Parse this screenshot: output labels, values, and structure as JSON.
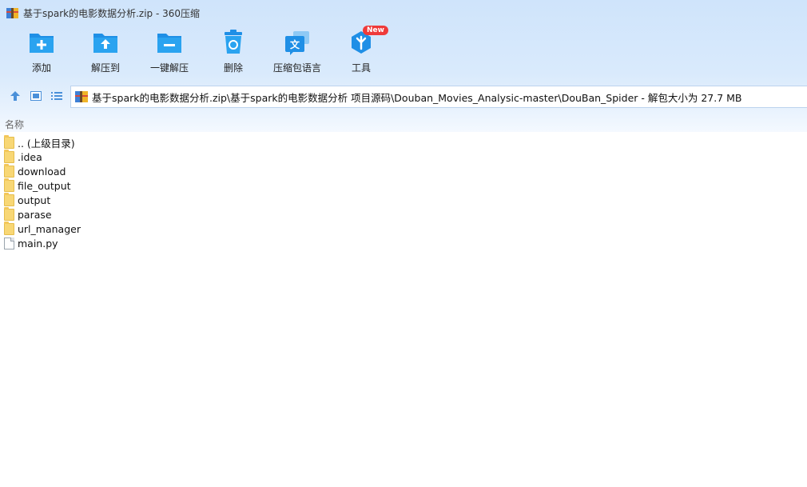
{
  "window": {
    "title": "基于spark的电影数据分析.zip - 360压缩"
  },
  "toolbar": {
    "items": [
      {
        "label": "添加",
        "icon": "add-folder-icon"
      },
      {
        "label": "解压到",
        "icon": "extract-to-icon"
      },
      {
        "label": "一键解压",
        "icon": "one-click-extract-icon"
      },
      {
        "label": "删除",
        "icon": "delete-trash-icon"
      },
      {
        "label": "压缩包语言",
        "icon": "archive-language-icon"
      },
      {
        "label": "工具",
        "icon": "tools-icon",
        "badge": "New"
      }
    ]
  },
  "nav": {
    "path": "基于spark的电影数据分析.zip\\基于spark的电影数据分析 项目源码\\Douban_Movies_Analysic-master\\DouBan_Spider - 解包大小为 27.7 MB"
  },
  "columns": {
    "name": "名称"
  },
  "files": [
    {
      "name": ".. (上级目录)",
      "type": "folder"
    },
    {
      "name": ".idea",
      "type": "folder"
    },
    {
      "name": "download",
      "type": "folder"
    },
    {
      "name": "file_output",
      "type": "folder"
    },
    {
      "name": "output",
      "type": "folder"
    },
    {
      "name": "parase",
      "type": "folder"
    },
    {
      "name": "url_manager",
      "type": "folder"
    },
    {
      "name": "main.py",
      "type": "file"
    }
  ],
  "colors": {
    "accent": "#2d9be8",
    "badge": "#ef3a3a",
    "folder": "#f8d775"
  }
}
